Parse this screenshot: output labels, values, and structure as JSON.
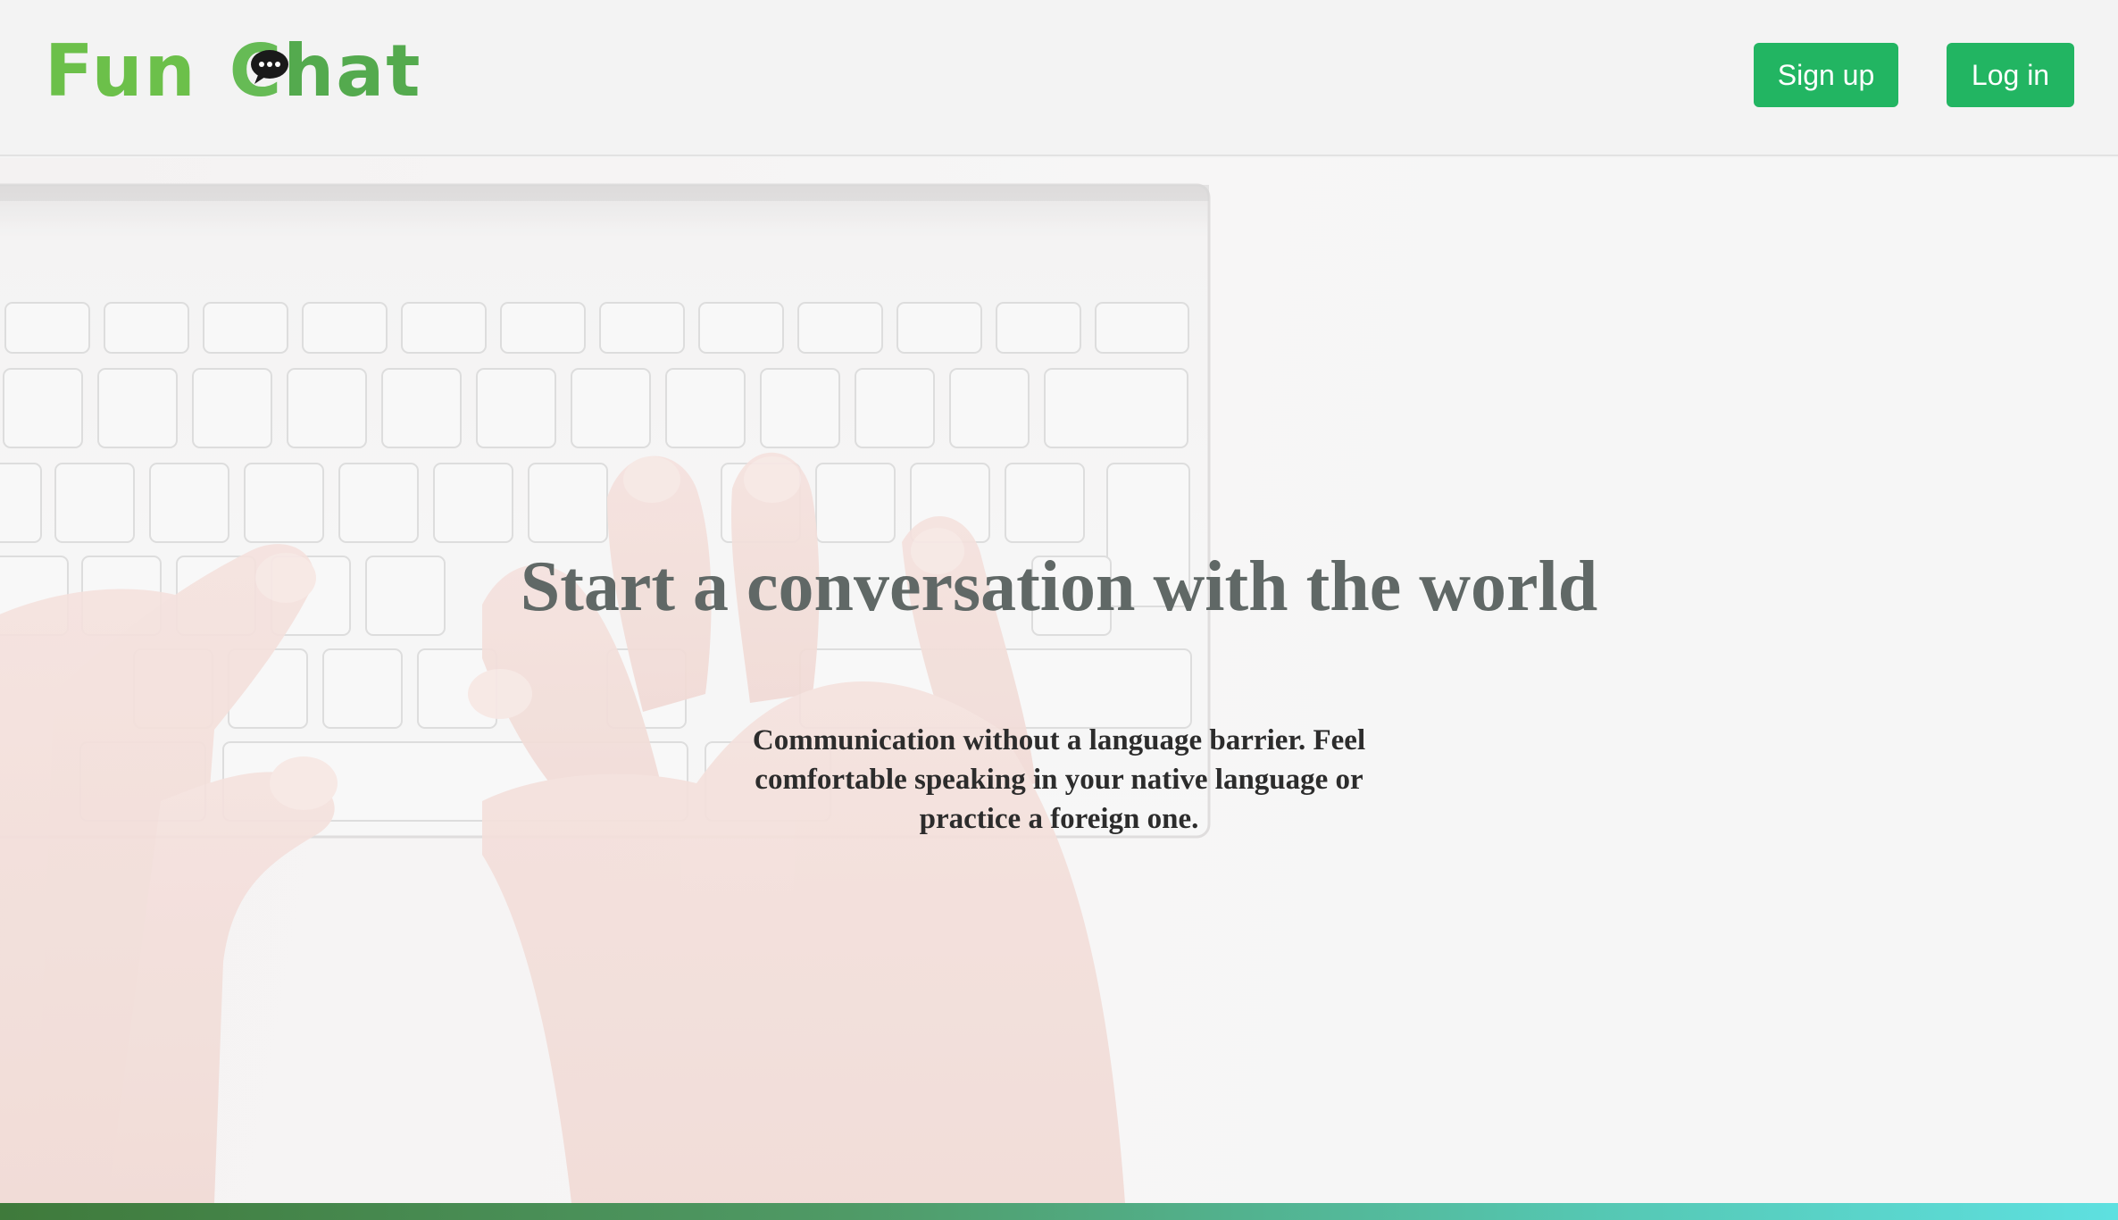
{
  "header": {
    "logo": {
      "word1": "Fun",
      "word2_first": "C",
      "word2_rest": "hat",
      "icon": "speech-bubble-icon"
    },
    "signup_label": "Sign up",
    "login_label": "Log in"
  },
  "hero": {
    "title": "Start a conversation with the world",
    "subtitle": "Communication without a language barrier. Feel comfortable speaking in your native language or practice a foreign one.",
    "background_image": "hands-typing-on-keyboard"
  },
  "colors": {
    "button": "#22b562",
    "logo_green": "#66bb55",
    "title": "#606866",
    "bottom_gradient_start": "#3f7a3b",
    "bottom_gradient_end": "#5ee0e0"
  }
}
